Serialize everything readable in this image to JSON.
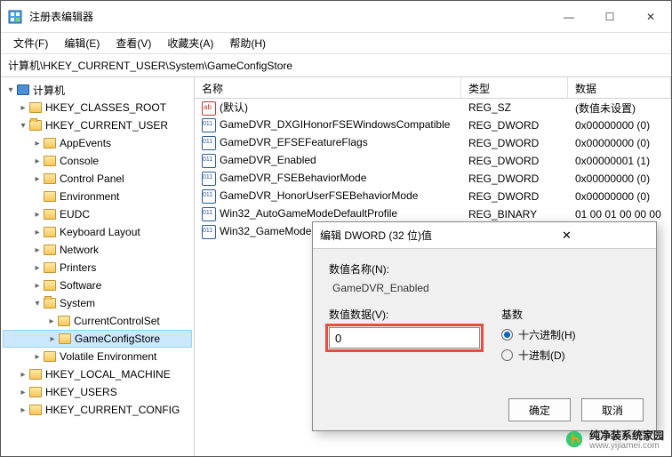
{
  "window": {
    "title": "注册表编辑器",
    "minimize": "—",
    "maximize": "☐",
    "close": "✕"
  },
  "menu": {
    "file": "文件(F)",
    "edit": "编辑(E)",
    "view": "查看(V)",
    "favorites": "收藏夹(A)",
    "help": "帮助(H)"
  },
  "address": "计算机\\HKEY_CURRENT_USER\\System\\GameConfigStore",
  "tree": {
    "root": "计算机",
    "hkcr": "HKEY_CLASSES_ROOT",
    "hkcu": "HKEY_CURRENT_USER",
    "appev": "AppEvents",
    "console": "Console",
    "cp": "Control Panel",
    "env": "Environment",
    "eudc": "EUDC",
    "keyboard": "Keyboard Layout",
    "network": "Network",
    "printers": "Printers",
    "software": "Software",
    "system": "System",
    "ccs": "CurrentControlSet",
    "gcs": "GameConfigStore",
    "venv": "Volatile Environment",
    "hklm": "HKEY_LOCAL_MACHINE",
    "hku": "HKEY_USERS",
    "hkcc": "HKEY_CURRENT_CONFIG"
  },
  "columns": {
    "name": "名称",
    "type": "类型",
    "data": "数据"
  },
  "rows": [
    {
      "icon": "ab",
      "name": "(默认)",
      "type": "REG_SZ",
      "data": "(数值未设置)"
    },
    {
      "icon": "bin",
      "name": "GameDVR_DXGIHonorFSEWindowsCompatible",
      "type": "REG_DWORD",
      "data": "0x00000000 (0)"
    },
    {
      "icon": "bin",
      "name": "GameDVR_EFSEFeatureFlags",
      "type": "REG_DWORD",
      "data": "0x00000000 (0)"
    },
    {
      "icon": "bin",
      "name": "GameDVR_Enabled",
      "type": "REG_DWORD",
      "data": "0x00000001 (1)"
    },
    {
      "icon": "bin",
      "name": "GameDVR_FSEBehaviorMode",
      "type": "REG_DWORD",
      "data": "0x00000000 (0)"
    },
    {
      "icon": "bin",
      "name": "GameDVR_HonorUserFSEBehaviorMode",
      "type": "REG_DWORD",
      "data": "0x00000000 (0)"
    },
    {
      "icon": "bin",
      "name": "Win32_AutoGameModeDefaultProfile",
      "type": "REG_BINARY",
      "data": "01 00 01 00 00 00"
    },
    {
      "icon": "bin",
      "name": "Win32_GameModeR",
      "type": "",
      "data": ""
    }
  ],
  "dialog": {
    "title": "编辑 DWORD (32 位)值",
    "name_label": "数值名称(N):",
    "name_value": "GameDVR_Enabled",
    "data_label": "数值数据(V):",
    "data_value": "0",
    "base_label": "基数",
    "hex": "十六进制(H)",
    "dec": "十进制(D)",
    "ok": "确定",
    "cancel": "取消"
  },
  "watermark": {
    "text": "纯净装系统家园",
    "sub": "www.yijiamei.com"
  }
}
